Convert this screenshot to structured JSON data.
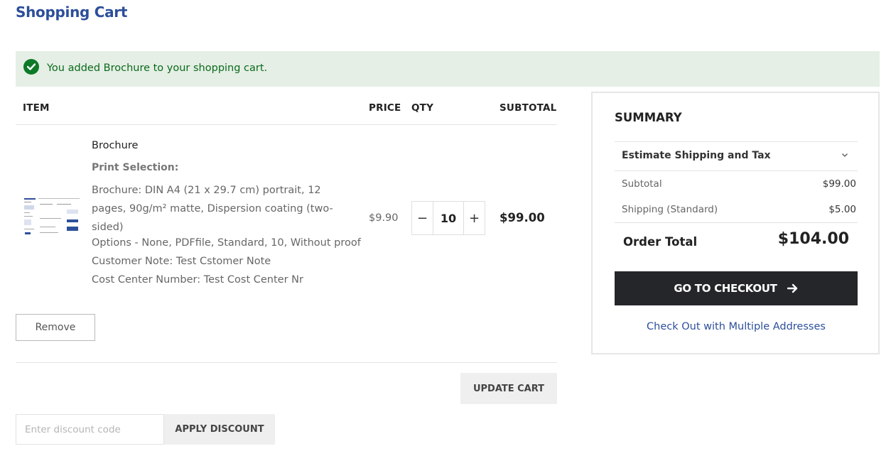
{
  "page": {
    "title": "Shopping Cart"
  },
  "message": {
    "text": "You added Brochure to your shopping cart.",
    "color": "#0a6a1c"
  },
  "cart": {
    "headers": {
      "item": "ITEM",
      "price": "PRICE",
      "qty": "QTY",
      "subtotal": "SUBTOTAL"
    },
    "items": [
      {
        "name": "Brochure",
        "options_label": "Print Selection:",
        "options_value": "Brochure: DIN A4 (21 x 29.7 cm) portrait, 12 pages, 90g/m² matte, Dispersion coating (two-sided)",
        "options_line": "Options - None, PDFfile, Standard, 10, Without proof",
        "customer_note": "Customer Note: Test Cstomer Note",
        "cost_center": "Cost Center Number: Test Cost Center Nr",
        "price": "$9.90",
        "qty": "10",
        "subtotal": "$99.00"
      }
    ],
    "remove_label": "Remove",
    "update_label": "UPDATE CART"
  },
  "discount": {
    "placeholder": "Enter discount code",
    "button_label": "APPLY DISCOUNT"
  },
  "summary": {
    "title": "SUMMARY",
    "estimate_label": "Estimate Shipping and Tax",
    "subtotal_label": "Subtotal",
    "subtotal_value": "$99.00",
    "shipping_label": "Shipping (Standard)",
    "shipping_value": "$5.00",
    "total_label": "Order Total",
    "total_value": "$104.00",
    "checkout_label": "GO TO CHECKOUT",
    "multi_address_label": "Check Out with Multiple Addresses"
  },
  "colors": {
    "brand_blue": "#2d4f9a",
    "success_bg": "#e5efe5",
    "success_icon": "#0c7a28",
    "checkout_bg": "#25262a"
  },
  "icons": [
    "check-circle-icon",
    "minus-icon",
    "plus-icon",
    "chevron-down-icon",
    "arrow-right-icon"
  ]
}
